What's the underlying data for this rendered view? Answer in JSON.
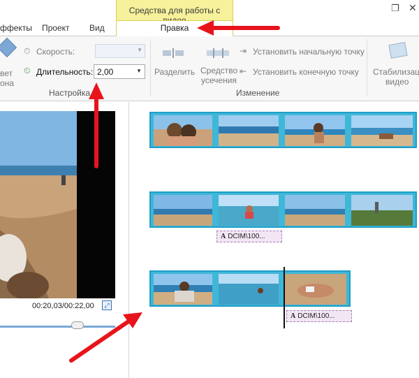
{
  "window": {
    "context_header": "Средства для работы с видео",
    "restore_glyph": "❐",
    "close_glyph": "✕"
  },
  "tabs": {
    "effects": "ффекты",
    "project": "Проект",
    "view": "Вид",
    "edit": "Правка"
  },
  "ribbon": {
    "color_label_1": "вет",
    "color_label_2": "она",
    "speed_label": "Скорость:",
    "speed_value": "",
    "duration_label": "Длительность:",
    "duration_value": "2,00",
    "group_settings": "Настройка",
    "split_label": "Разделить",
    "trim_label_1": "Средство",
    "trim_label_2": "усечения",
    "set_start": "Установить начальную точку",
    "set_end": "Установить конечную точку",
    "group_edit": "Изменение",
    "stabilize_label_1": "Стабилизация",
    "stabilize_label_2": "видео"
  },
  "preview": {
    "timecode": "00:20,03/00:22,00",
    "seek_position": 0.67
  },
  "storyboard": {
    "captions": [
      "DCIM\\100...",
      "DCIM\\100..."
    ],
    "caption_icon": "A"
  },
  "colors": {
    "accent_tab": "#f6f19a",
    "clip_border": "#3fb7d8",
    "caption_bg": "#f2e6f5",
    "arrow": "#e8141c"
  }
}
